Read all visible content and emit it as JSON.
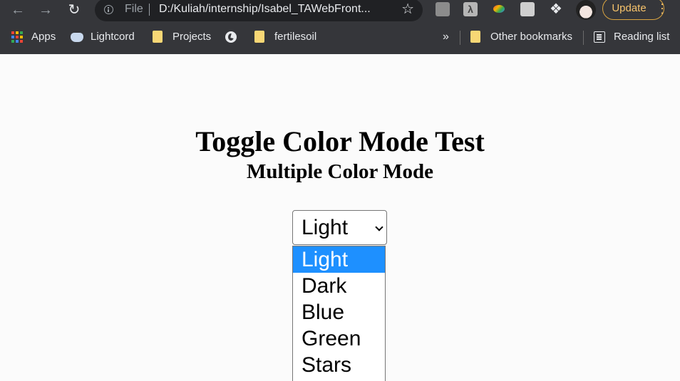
{
  "browser": {
    "omnibox": {
      "scheme": "File",
      "url": "D:/Kuliah/internship/Isabel_TAWebFront..."
    },
    "update_label": "Update",
    "bookmarks": [
      {
        "label": "Apps",
        "icon": "apps-grid-icon"
      },
      {
        "label": "Lightcord",
        "icon": "discord-icon"
      },
      {
        "label": "Projects",
        "icon": "folder-icon"
      },
      {
        "label": "",
        "icon": "globe-icon"
      },
      {
        "label": "fertilesoil",
        "icon": "folder-icon"
      }
    ],
    "overflow_label": "»",
    "other_bookmarks": "Other bookmarks",
    "reading_list": "Reading list"
  },
  "page": {
    "title": "Toggle Color Mode Test",
    "subtitle": "Multiple Color Mode",
    "select": {
      "value": "Light",
      "options": [
        "Light",
        "Dark",
        "Blue",
        "Green",
        "Stars"
      ],
      "highlighted_index": 0
    }
  },
  "colors": {
    "chrome_bg": "#35363a",
    "omnibox_bg": "#202124",
    "update_accent": "#f5c26b",
    "option_highlight": "#1e90ff",
    "page_bg": "#fbfbfb"
  }
}
